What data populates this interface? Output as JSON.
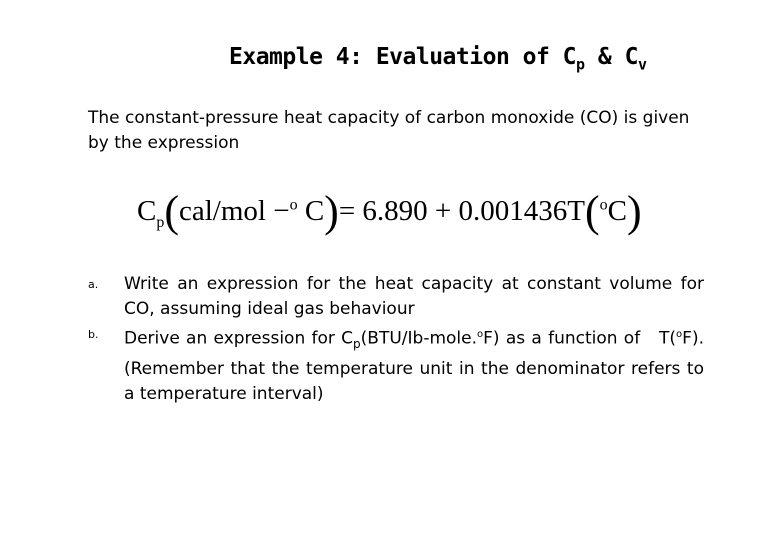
{
  "title": {
    "main": "Example 4: Evaluation of C",
    "sub1": "p",
    "mid": " & C",
    "sub2": "v"
  },
  "intro": "The constant-pressure heat capacity of carbon monoxide (CO)  is given by the expression",
  "equation": {
    "lhs": "C",
    "lhs_sub": "p",
    "unit_open": "(",
    "unit": "cal/mol −",
    "deg": "o",
    "unit_c": " C",
    "unit_close": ")",
    "rhs": "= 6.890 + 0.001436T",
    "t_open": "(",
    "t_deg": "o",
    "t_c": "C",
    "t_close": ")"
  },
  "items": [
    {
      "marker": "a.",
      "text": "Write an expression for the heat capacity at constant volume for CO, assuming ideal gas behaviour"
    },
    {
      "marker": "b.",
      "pre": "Derive an expression for C",
      "sub": "p",
      "mid": "(BTU/Ib-mole.",
      "sup1": "o",
      "post1": "F) as a function of   T(",
      "sup2": "o",
      "post2": "F). (Remember that the temperature unit in the denominator refers to a temperature interval)"
    }
  ]
}
